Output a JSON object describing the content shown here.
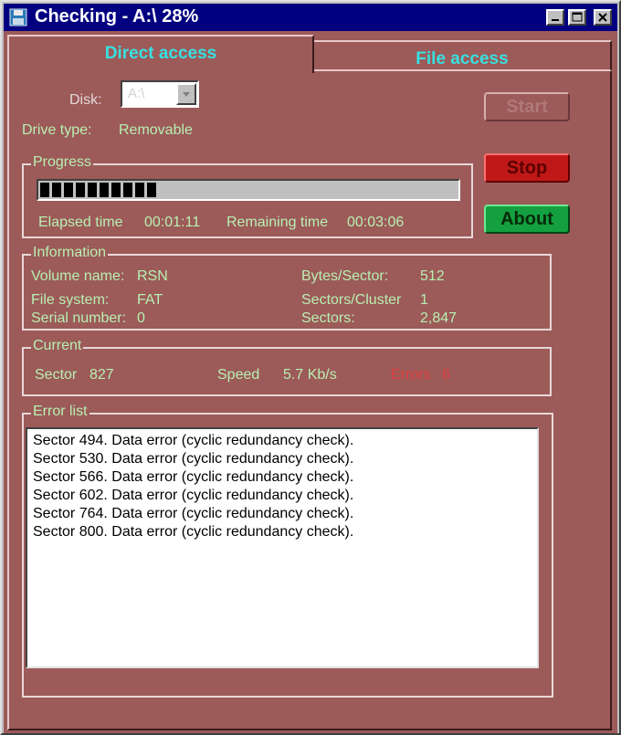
{
  "window": {
    "title": "Checking - A:\\ 28%",
    "icon": "floppy-disk-icon",
    "controls": [
      "minimize-icon",
      "maximize-icon",
      "close-icon"
    ]
  },
  "tabs": [
    {
      "label": "Direct access",
      "active": true
    },
    {
      "label": "File access",
      "active": false
    }
  ],
  "disk": {
    "label": "Disk:",
    "value": "A:\\"
  },
  "drive_type": {
    "label": "Drive type:",
    "value": "Removable"
  },
  "buttons": {
    "start": "Start",
    "stop": "Stop",
    "about": "About"
  },
  "progress": {
    "legend": "Progress",
    "fraction": 0.28,
    "elapsed_label": "Elapsed time",
    "elapsed_value": "00:01:11",
    "remaining_label": "Remaining time",
    "remaining_value": "00:03:06"
  },
  "information": {
    "legend": "Information",
    "volume_name_label": "Volume name:",
    "volume_name_value": "RSN",
    "file_system_label": "File system:",
    "file_system_value": "FAT",
    "serial_number_label": "Serial number:",
    "serial_number_value": "0",
    "bytes_per_sector_label": "Bytes/Sector:",
    "bytes_per_sector_value": "512",
    "sectors_per_cluster_label": "Sectors/Cluster",
    "sectors_per_cluster_value": "1",
    "sectors_label": "Sectors:",
    "sectors_value": "2,847"
  },
  "current": {
    "legend": "Current",
    "sector_label": "Sector",
    "sector_value": "827",
    "speed_label": "Speed",
    "speed_value": "5.7 Kb/s",
    "errors_label": "Errors",
    "errors_value": "6"
  },
  "error_list": {
    "legend": "Error list",
    "items": [
      "Sector 494. Data error (cyclic redundancy check).",
      "Sector 530. Data error (cyclic redundancy check).",
      "Sector 566. Data error (cyclic redundancy check).",
      "Sector 602. Data error (cyclic redundancy check).",
      "Sector 764. Data error (cyclic redundancy check).",
      "Sector 800. Data error (cyclic redundancy check)."
    ]
  },
  "colors": {
    "title_bar": "#000080",
    "panel_bg": "#9c5a59",
    "label_text": "#b8f0b0",
    "tab_text": "#39e0e0",
    "stop_button": "#c01818",
    "about_button": "#14a040",
    "errors_text": "#e04040"
  }
}
